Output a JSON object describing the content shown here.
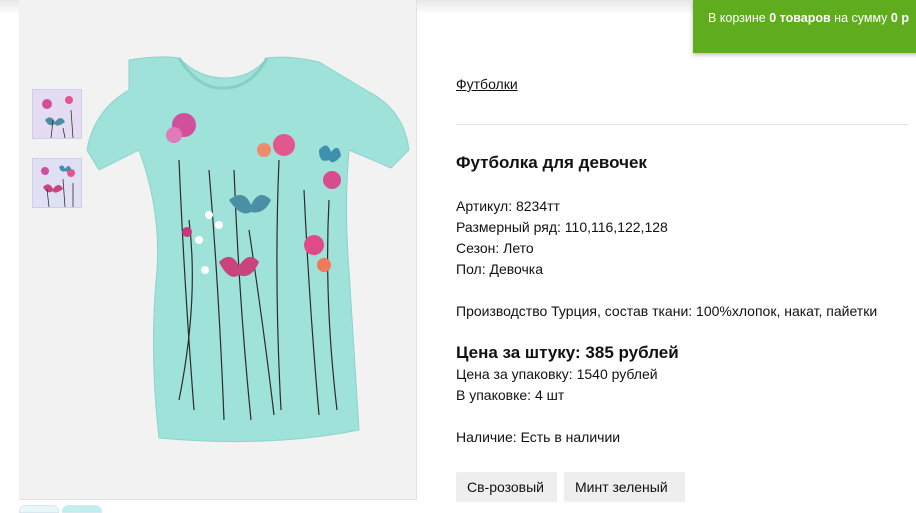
{
  "cart": {
    "prefix": "В корзине ",
    "count": "0 товаров",
    "middle": " на сумму ",
    "sum": "0 р"
  },
  "breadcrumb": "Футболки",
  "product": {
    "title": "Футболка для девочек",
    "article": "Артикул: 8234тт",
    "sizes": "Размерный ряд: 110,116,122,128",
    "season": "Сезон: Лето",
    "gender": "Пол: Девочка",
    "composition": "Производство Турция, состав ткани: 100%хлопок, накат, пайетки",
    "price_unit": "Цена за штуку: 385 рублей",
    "price_pack": "Цена за упаковку: 1540 рублей",
    "pack_qty": "В упаковке: 4 шт",
    "availability": "Наличие: Есть в наличии"
  },
  "colors": [
    "Св-розовый",
    "Минт зеленый"
  ],
  "image": {
    "main": "mint-tshirt-with-flowers-and-butterflies",
    "thumbs": [
      "pink-tshirt-thumb",
      "lilac-tshirt-thumb"
    ],
    "accent": "#9fe3d9"
  }
}
